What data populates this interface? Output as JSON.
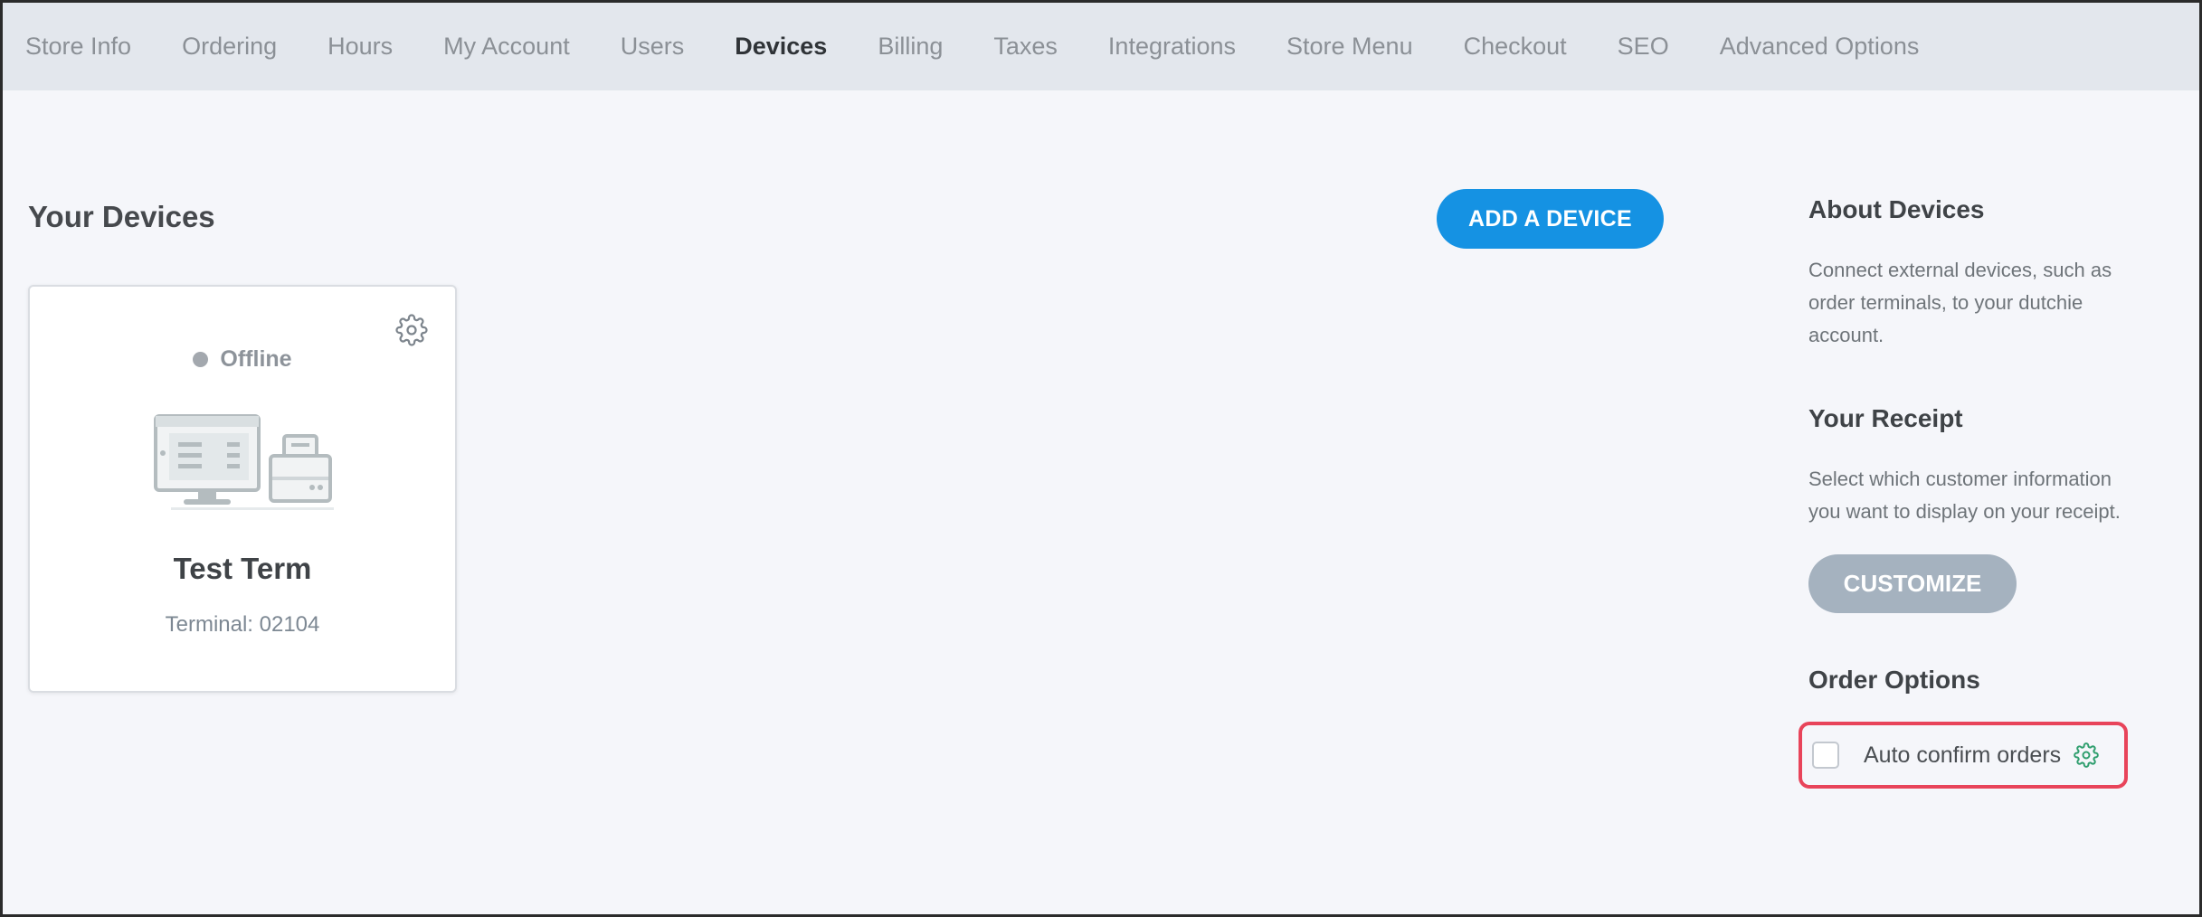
{
  "nav": {
    "tabs": [
      {
        "label": "Store Info"
      },
      {
        "label": "Ordering"
      },
      {
        "label": "Hours"
      },
      {
        "label": "My Account"
      },
      {
        "label": "Users"
      },
      {
        "label": "Devices",
        "active": true
      },
      {
        "label": "Billing"
      },
      {
        "label": "Taxes"
      },
      {
        "label": "Integrations"
      },
      {
        "label": "Store Menu"
      },
      {
        "label": "Checkout"
      },
      {
        "label": "SEO"
      },
      {
        "label": "Advanced Options"
      }
    ]
  },
  "main": {
    "title": "Your Devices",
    "add_button": "ADD A DEVICE",
    "devices": [
      {
        "status": "Offline",
        "name": "Test Term",
        "terminal": "Terminal: 02104",
        "icon": "gear-icon"
      }
    ]
  },
  "side": {
    "about_title": "About Devices",
    "about_text_lines": [
      "Connect external devices, such as",
      "order terminals, to your dutchie",
      "account."
    ],
    "receipt_title": "Your Receipt",
    "receipt_text_lines": [
      "Select which customer information",
      "you want to display on your receipt."
    ],
    "customize_button": "CUSTOMIZE",
    "order_options_title": "Order Options",
    "auto_confirm_label": "Auto confirm orders",
    "auto_confirm_checked": false
  },
  "colors": {
    "accent": "#1592e3",
    "highlight": "#e8445a",
    "nav_bg": "#e3e7ed",
    "page_bg": "#f5f6fa",
    "gear_green": "#2f9e6e"
  }
}
